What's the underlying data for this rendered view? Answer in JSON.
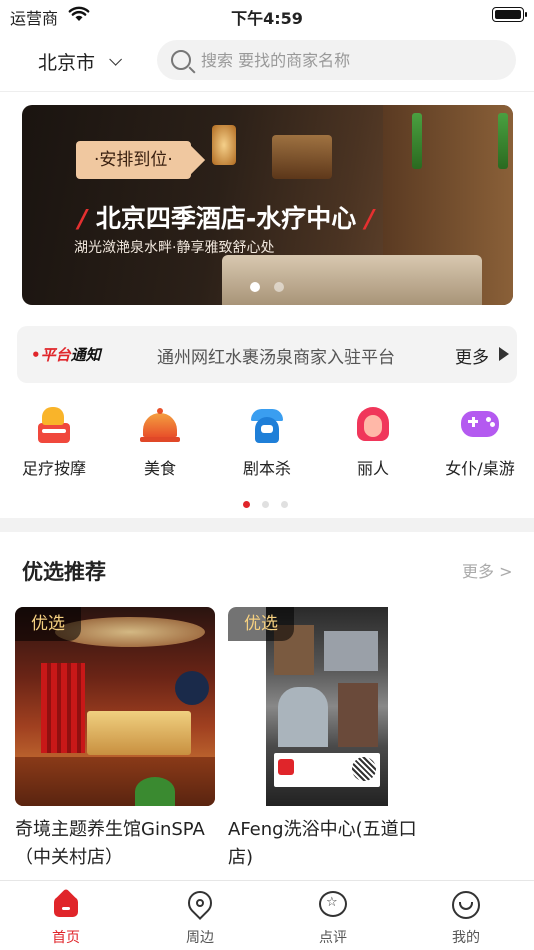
{
  "status_bar": {
    "carrier": "运营商",
    "time": "下午4:59"
  },
  "header": {
    "city": "北京市",
    "search_placeholder": "搜索 要找的商家名称"
  },
  "banner": {
    "badge": "·安排到位·",
    "title": "北京四季酒店-水疗中心",
    "title_prefix": "/",
    "title_suffix": "/",
    "subtitle": "湖光潋滟泉水畔·静享雅致舒心处",
    "page_count": 2,
    "active_page": 1
  },
  "notice": {
    "tag_dot": "•",
    "tag_a": "平台",
    "tag_b": "通知",
    "text": "通州网红水裹汤泉商家入驻平台",
    "more": "更多"
  },
  "categories": [
    {
      "label": "足疗按摩",
      "icon": "foot-massage-icon"
    },
    {
      "label": "美食",
      "icon": "food-cloche-icon"
    },
    {
      "label": "剧本杀",
      "icon": "script-mystery-icon"
    },
    {
      "label": "丽人",
      "icon": "beauty-woman-icon"
    },
    {
      "label": "女仆/桌游",
      "icon": "gamepad-icon"
    }
  ],
  "category_pager": {
    "count": 3,
    "active": 1
  },
  "featured": {
    "title": "优选推荐",
    "more": "更多 >",
    "items": [
      {
        "badge": "优选",
        "name": "奇境主题养生馆GinSPA（中关村店）"
      },
      {
        "badge": "优选",
        "name": "AFeng洗浴中心(五道口店)"
      }
    ]
  },
  "tabbar": {
    "active": "首页",
    "tabs": [
      {
        "label": "首页",
        "icon": "home-icon"
      },
      {
        "label": "周边",
        "icon": "location-pin-icon"
      },
      {
        "label": "点评",
        "icon": "star-review-icon"
      },
      {
        "label": "我的",
        "icon": "smile-profile-icon"
      }
    ]
  },
  "colors": {
    "accent": "#e0252a",
    "badge_text": "#f5d080",
    "banner_badge": "#f0c8a0"
  }
}
